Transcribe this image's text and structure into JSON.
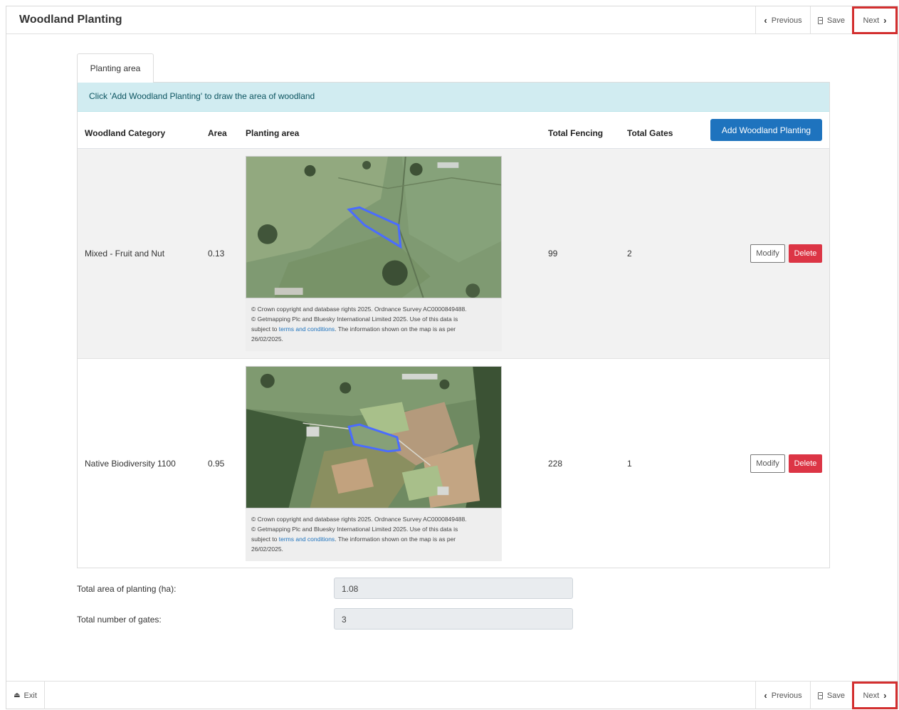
{
  "header": {
    "title": "Woodland Planting",
    "previous_label": "Previous",
    "save_label": "Save",
    "next_label": "Next"
  },
  "tab": {
    "label": "Planting area"
  },
  "info": "Click 'Add Woodland Planting' to draw the area of woodland",
  "table": {
    "columns": [
      "Woodland Category",
      "Area",
      "Planting area",
      "Total Fencing",
      "Total Gates"
    ],
    "add_button": "Add Woodland Planting",
    "copyright": {
      "line1": "© Crown copyright and database rights 2025. Ordnance Survey AC0000849488.",
      "line2": "© Getmapping Plc and Bluesky International Limited 2025. Use of this data is",
      "line3a": "subject to ",
      "link": "terms and conditions",
      "line3b": ". The information shown on the map is as per",
      "date": "26/02/2025."
    },
    "rows": [
      {
        "category": "Mixed - Fruit and Nut",
        "area": "0.13",
        "fencing": "99",
        "gates": "2",
        "modify": "Modify",
        "delete": "Delete"
      },
      {
        "category": "Native Biodiversity 1100",
        "area": "0.95",
        "fencing": "228",
        "gates": "1",
        "modify": "Modify",
        "delete": "Delete"
      }
    ]
  },
  "summary": {
    "total_area_label": "Total area of planting (ha):",
    "total_area_value": "1.08",
    "total_gates_label": "Total number of gates:",
    "total_gates_value": "3"
  },
  "footer": {
    "exit_label": "Exit",
    "previous_label": "Previous",
    "save_label": "Save",
    "next_label": "Next"
  },
  "colors": {
    "primary": "#1e73be",
    "danger": "#dc3545",
    "info_bg": "#d1ecf1",
    "highlight": "#d32f2f",
    "polygon": "#4a6cff"
  }
}
